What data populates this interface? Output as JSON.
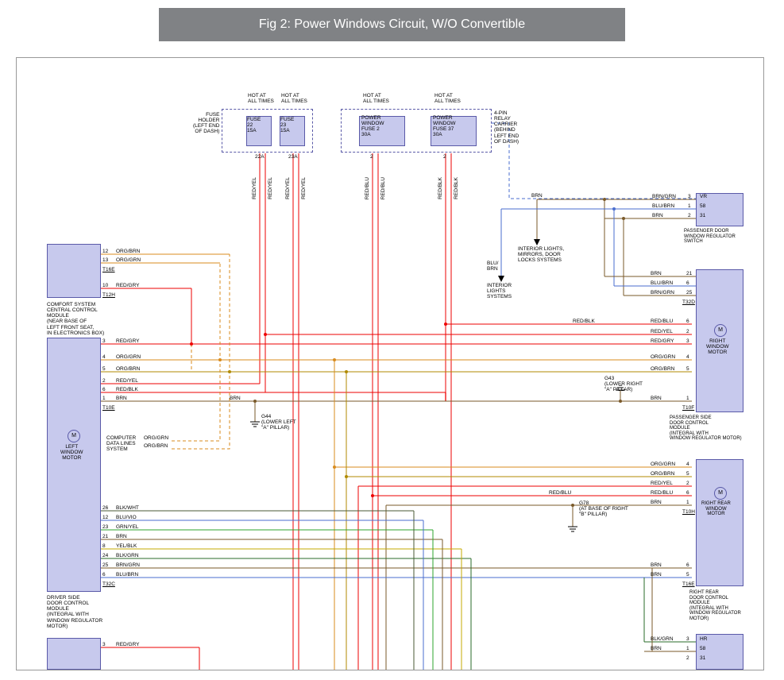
{
  "title": "Fig 2: Power Windows Circuit, W/O Convertible",
  "fuseHolder": {
    "label": "FUSE\nHOLDER\n(LEFT END\nOF DASH)",
    "f22": "FUSE\n22\n15A",
    "f23": "FUSE\n23\n15A",
    "hot": "HOT AT\nALL TIMES",
    "pin22": "22A",
    "pin23": "23A"
  },
  "relayCarrier": {
    "label": "4-PIN\nRELAY\nCARRIER\n(BEHIND\nLEFT END\nOF DASH)",
    "f2": "POWER\nWINDOW\nFUSE 2\n30A",
    "f37": "POWER\nWINDOW\nFUSE 37\n30A",
    "hot": "HOT AT\nALL TIMES",
    "pin2": "2",
    "pin37": "2"
  },
  "comfModule": {
    "label": "COMFORT SYSTEM\nCENTRAL CONTROL\nMODULE\n(NEAR BASE OF\nLEFT FRONT SEAT,\nIN ELECTRONICS BOX)",
    "pins": [
      {
        "n": "12",
        "c": "ORG/BRN"
      },
      {
        "n": "13",
        "c": "ORG/GRN"
      },
      {
        "n": "10",
        "c": "RED/GRY"
      }
    ],
    "t1": "T16E",
    "t2": "T12H"
  },
  "driverModule": {
    "label": "DRIVER SIDE\nDOOR CONTROL\nMODULE\n(INTEGRAL WITH\nWINDOW REGULATOR\nMOTOR)",
    "motor": "LEFT\nWINDOW\nMOTOR",
    "topPins": [
      {
        "n": "3",
        "c": "RED/GRY"
      },
      {
        "n": "4",
        "c": "ORG/GRN"
      },
      {
        "n": "5",
        "c": "ORG/BRN"
      },
      {
        "n": "2",
        "c": "RED/YEL"
      },
      {
        "n": "6",
        "c": "RED/BLK"
      },
      {
        "n": "1",
        "c": "BRN"
      }
    ],
    "t1": "T10E",
    "dataLines": "COMPUTER\nDATA LINES\nSYSTEM",
    "dl1": "ORG/GRN",
    "dl2": "ORG/BRN",
    "botPins": [
      {
        "n": "26",
        "c": "BLK/WHT"
      },
      {
        "n": "12",
        "c": "BLU/VIO"
      },
      {
        "n": "23",
        "c": "GRN/YEL"
      },
      {
        "n": "21",
        "c": "BRN"
      },
      {
        "n": "8",
        "c": "YEL/BLK"
      },
      {
        "n": "24",
        "c": "BLK/GRN"
      },
      {
        "n": "25",
        "c": "BRN/GRN"
      },
      {
        "n": "6",
        "c": "BLU/BRN"
      }
    ],
    "t2": "T32C",
    "last": [
      {
        "n": "3",
        "c": "RED/GRY"
      }
    ]
  },
  "ground44": {
    "label": "G44\n(LOWER LEFT\n\"A\" PILLAR)",
    "wire": "BRN"
  },
  "ground43": {
    "label": "G43\n(LOWER RIGHT\n\"A\" PILLAR)"
  },
  "ground78": {
    "label": "G78\n(AT BASE OF RIGHT\n\"B\" PILLAR)"
  },
  "branches": {
    "brn": "BRN",
    "blubrn": "BLU/\nBRN",
    "intLights": "INTERIOR LIGHTS,\nMIRRORS, DOOR\nLOCKS SYSTEMS",
    "intLights2": "INTERIOR\nLIGHTS\nSYSTEMS"
  },
  "passSwitch": {
    "label": "PASSENGER DOOR\nWINDOW REGULATOR\nSWITCH",
    "pins": [
      {
        "c": "BRN/GRN",
        "n": "3",
        "r": "VR"
      },
      {
        "c": "BLU/BRN",
        "n": "1",
        "r": "58"
      },
      {
        "c": "BRN",
        "n": "2",
        "r": "31"
      }
    ]
  },
  "rightMotor": {
    "label": "RIGHT\nWINDOW\nMOTOR",
    "top": [
      {
        "c": "BRN",
        "n": "21"
      },
      {
        "c": "BLU/BRN",
        "n": "6"
      },
      {
        "c": "BRN/GRN",
        "n": "25"
      }
    ],
    "t1": "T32D",
    "mid": [
      {
        "c": "RED/BLU",
        "n": "6"
      },
      {
        "c": "RED/YEL",
        "n": "2"
      },
      {
        "c": "RED/GRY",
        "n": "3"
      }
    ],
    "bot": [
      {
        "c": "ORG/GRN",
        "n": "4"
      },
      {
        "c": "ORG/BRN",
        "n": "5"
      },
      {
        "c": "BRN",
        "n": "1"
      }
    ],
    "t2": "T10F",
    "modLabel": "PASSENGER SIDE\nDOOR CONTROL\nMODULE\n(INTEGRAL WITH\nWINDOW REGULATOR MOTOR)",
    "redblk": "RED/BLK"
  },
  "rightRearMotor": {
    "label": "RIGHT REAR\nWINDOW\nMOTOR",
    "top": [
      {
        "c": "ORG/GRN",
        "n": "4"
      },
      {
        "c": "ORG/BRN",
        "n": "5"
      },
      {
        "c": "RED/YEL",
        "n": "2"
      },
      {
        "c": "RED/BLU",
        "n": "6"
      },
      {
        "c": "BRN",
        "n": "1"
      }
    ],
    "t1": "T10H",
    "bot": [
      {
        "c": "BRN",
        "n": "6"
      },
      {
        "c": "BRN",
        "n": "5"
      }
    ],
    "t2": "T16E",
    "modLabel": "RIGHT REAR\nDOOR CONTROL\nMODULE\n(INTEGRAL WITH\nWINDOW REGULATOR\nMOTOR)",
    "redblu": "RED/BLU"
  },
  "bottomRight": {
    "pins": [
      {
        "c": "BLK/GRN",
        "n": "3",
        "r": "HR"
      },
      {
        "c": "BRN",
        "n": "1",
        "r": "58"
      },
      {
        "c": "",
        "n": "2",
        "r": "31"
      }
    ]
  },
  "wireColors": {
    "redyel": "RED/YEL",
    "redblu": "RED/BLU",
    "redblk": "RED/BLK"
  }
}
